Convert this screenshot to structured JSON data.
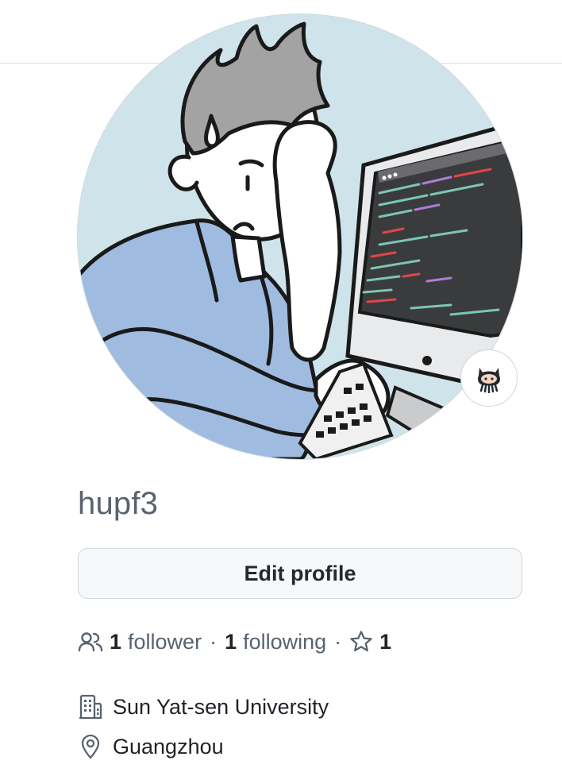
{
  "profile": {
    "username": "hupf3",
    "edit_button_label": "Edit profile",
    "followers_count": "1",
    "followers_label": "follower",
    "following_count": "1",
    "following_label": "following",
    "separator": "·",
    "stars_count": "1",
    "organization": "Sun Yat-sen University",
    "location": "Guangzhou"
  },
  "icons": {
    "followers": "people-icon",
    "stars": "star-icon",
    "organization": "organization-icon",
    "location": "location-pin-icon",
    "status": "octocat-icon"
  },
  "colors": {
    "text_primary": "#1f2328",
    "text_muted": "#59636e",
    "button_bg": "#f6f8fa",
    "border": "#d0d7de"
  }
}
